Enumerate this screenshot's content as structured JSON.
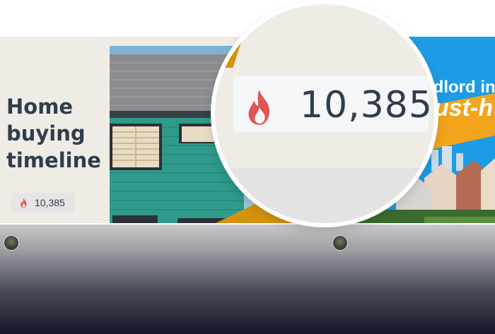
{
  "left_card": {
    "title": "Home\nbuying\ntimeline",
    "likes": "10,385"
  },
  "right_card": {
    "headline_line1": "ndlord ins",
    "headline_line2": "ust-h"
  },
  "magnifier": {
    "likes": "10,385"
  },
  "icons": {
    "flame": "fire-icon",
    "avatar": "user-avatar"
  },
  "colors": {
    "flame": "#e05555",
    "title": "#2f3d4c",
    "accent_yellow": "#d6920f",
    "right_card_bg": "#1e9be6"
  }
}
